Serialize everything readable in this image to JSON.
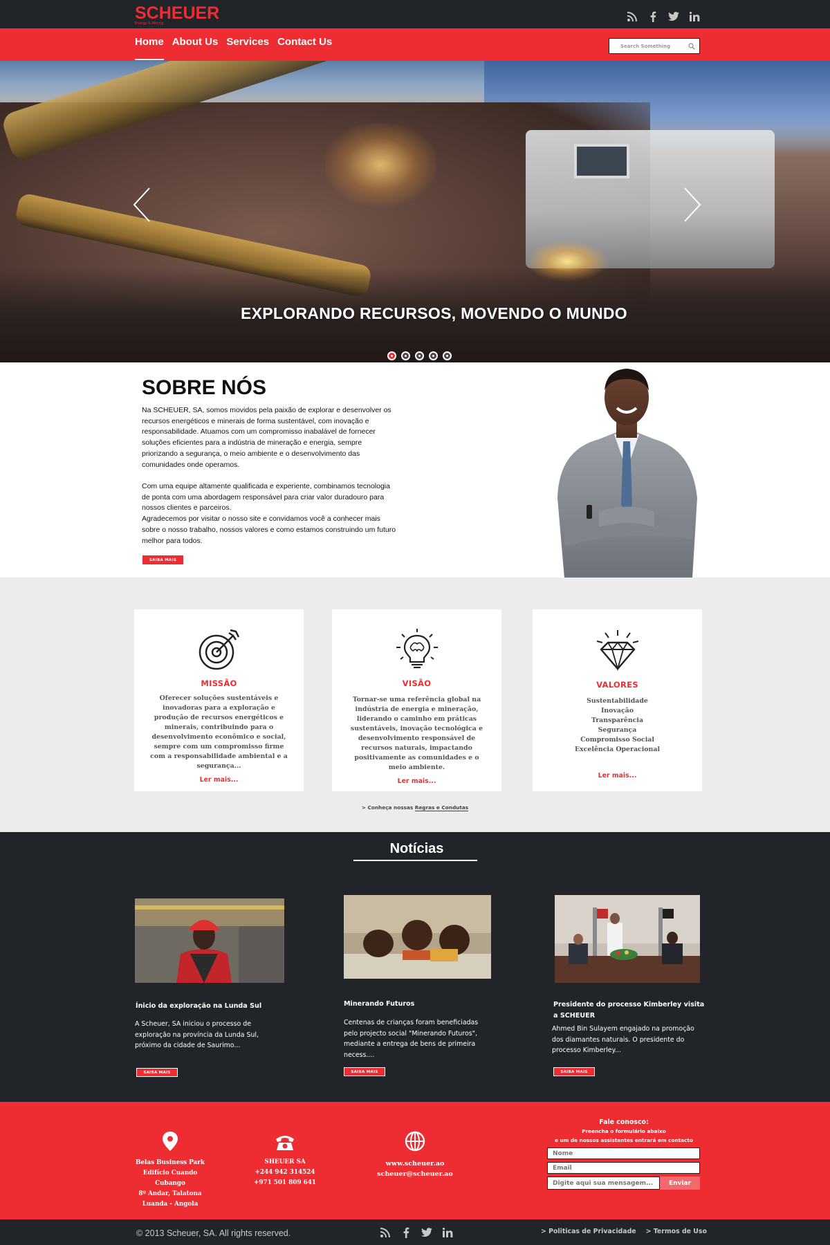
{
  "brand": {
    "name": "SCHEUER",
    "tagline": "Energy & Mining",
    "color": "#ee2d32"
  },
  "social": [
    "rss-icon",
    "facebook-icon",
    "twitter-icon",
    "linkedin-icon"
  ],
  "nav": {
    "items": [
      "Home",
      "About Us",
      "Services",
      "Contact Us"
    ],
    "active": "Home",
    "search_placeholder": "Search Something"
  },
  "hero": {
    "caption": "EXPLORANDO RECURSOS, MOVENDO O MUNDO",
    "slides": 5,
    "active_slide": 1
  },
  "about": {
    "title": "SOBRE NÓS",
    "p1": "Na SCHEUER, SA, somos movidos pela paixão de explorar e desenvolver os recursos energéticos e minerais de forma sustentável, com inovação e responsabilidade. Atuamos com um compromisso inabalável de fornecer soluções eficientes para a indústria de mineração e energia, sempre priorizando a segurança, o meio ambiente e o desenvolvimento das comunidades onde operamos.",
    "p2": "Com uma equipe altamente qualificada e experiente, combinamos tecnologia de ponta com uma abordagem responsável para criar valor duradouro para nossos clientes e parceiros.",
    "p3": "Agradecemos por visitar o nosso site e convidamos você a conhecer mais sobre o nosso trabalho, nossos valores e como estamos construindo um futuro melhor para todos.",
    "button": "SAIBA MAIS"
  },
  "cards": [
    {
      "icon": "target-icon",
      "title": "MISSÃO",
      "text": "Oferecer soluções sustentáveis e inovadoras para a exploração e produção de recursos energéticos e minerais, contribuindo para o desenvolvimento econômico e social, sempre com um compromisso firme com a responsabilidade ambiental e a segurança...",
      "link": "Ler mais..."
    },
    {
      "icon": "lightbulb-icon",
      "title": "VISÃO",
      "text": "Tornar-se uma referência global na indústria de energia e mineração, liderando o caminho em práticas sustentáveis, inovação tecnológica e desenvolvimento responsável de recursos naturais, impactando positivamente as comunidades e o meio ambiente.",
      "link": "Ler mais..."
    },
    {
      "icon": "diamond-icon",
      "title": "VALORES",
      "list": [
        "Sustentabilidade",
        "Inovação",
        "Transparência",
        "Segurança",
        "Compromisso Social",
        "Excelência Operacional"
      ],
      "link": "Ler mais..."
    }
  ],
  "rules": {
    "prefix": "> Conheça nossas ",
    "link": "Regras e Condutas"
  },
  "news": {
    "title": "Notícias",
    "items": [
      {
        "title": "Ínicio da exploração na Lunda Sul",
        "text": "A Scheuer, SA iniciou o processo de exploração na província da Lunda Sul, próximo da cidade de Saurimo...",
        "button": "SAIBA MAIS"
      },
      {
        "title": "Minerando Futuros",
        "text": "Centenas de crianças foram beneficiadas pelo projecto social \"Minerando Futuros\", mediante a entrega de bens de primeira necess....",
        "button": "SAIBA MAIS"
      },
      {
        "title": "Presidente do processo Kimberley visita a SCHEUER",
        "text": "Ahmed Bin Sulayem engajado na promoção dos diamantes naturais. O presidente do processo Kimberley...",
        "button": "SAIBA MAIS"
      }
    ]
  },
  "footer": {
    "address": [
      "Belas Business Park",
      "Edifício Cuando Cubango",
      "8º Andar, Talatona",
      "Luanda - Angola"
    ],
    "phone": [
      "SHEUER SA",
      "+244 942 314524",
      "+971 501 809 641"
    ],
    "web": [
      "www.scheuer.ao",
      "scheuer@scheuer.ao"
    ],
    "form": {
      "title": "Fale conosco:",
      "sub1": "Preencha o formulário abaixo",
      "sub2": "e um de nossos assistentes entrará em contacto",
      "name_placeholder": "Nome",
      "email_placeholder": "Email",
      "message_placeholder": "Digite aqui sua mensagem...",
      "send": "Enviar"
    }
  },
  "bottom": {
    "copyright": "© 2013 Scheuer, SA. All rights reserved.",
    "privacy": "> Politicas de Privacidade",
    "terms": "> Termos de Uso"
  }
}
